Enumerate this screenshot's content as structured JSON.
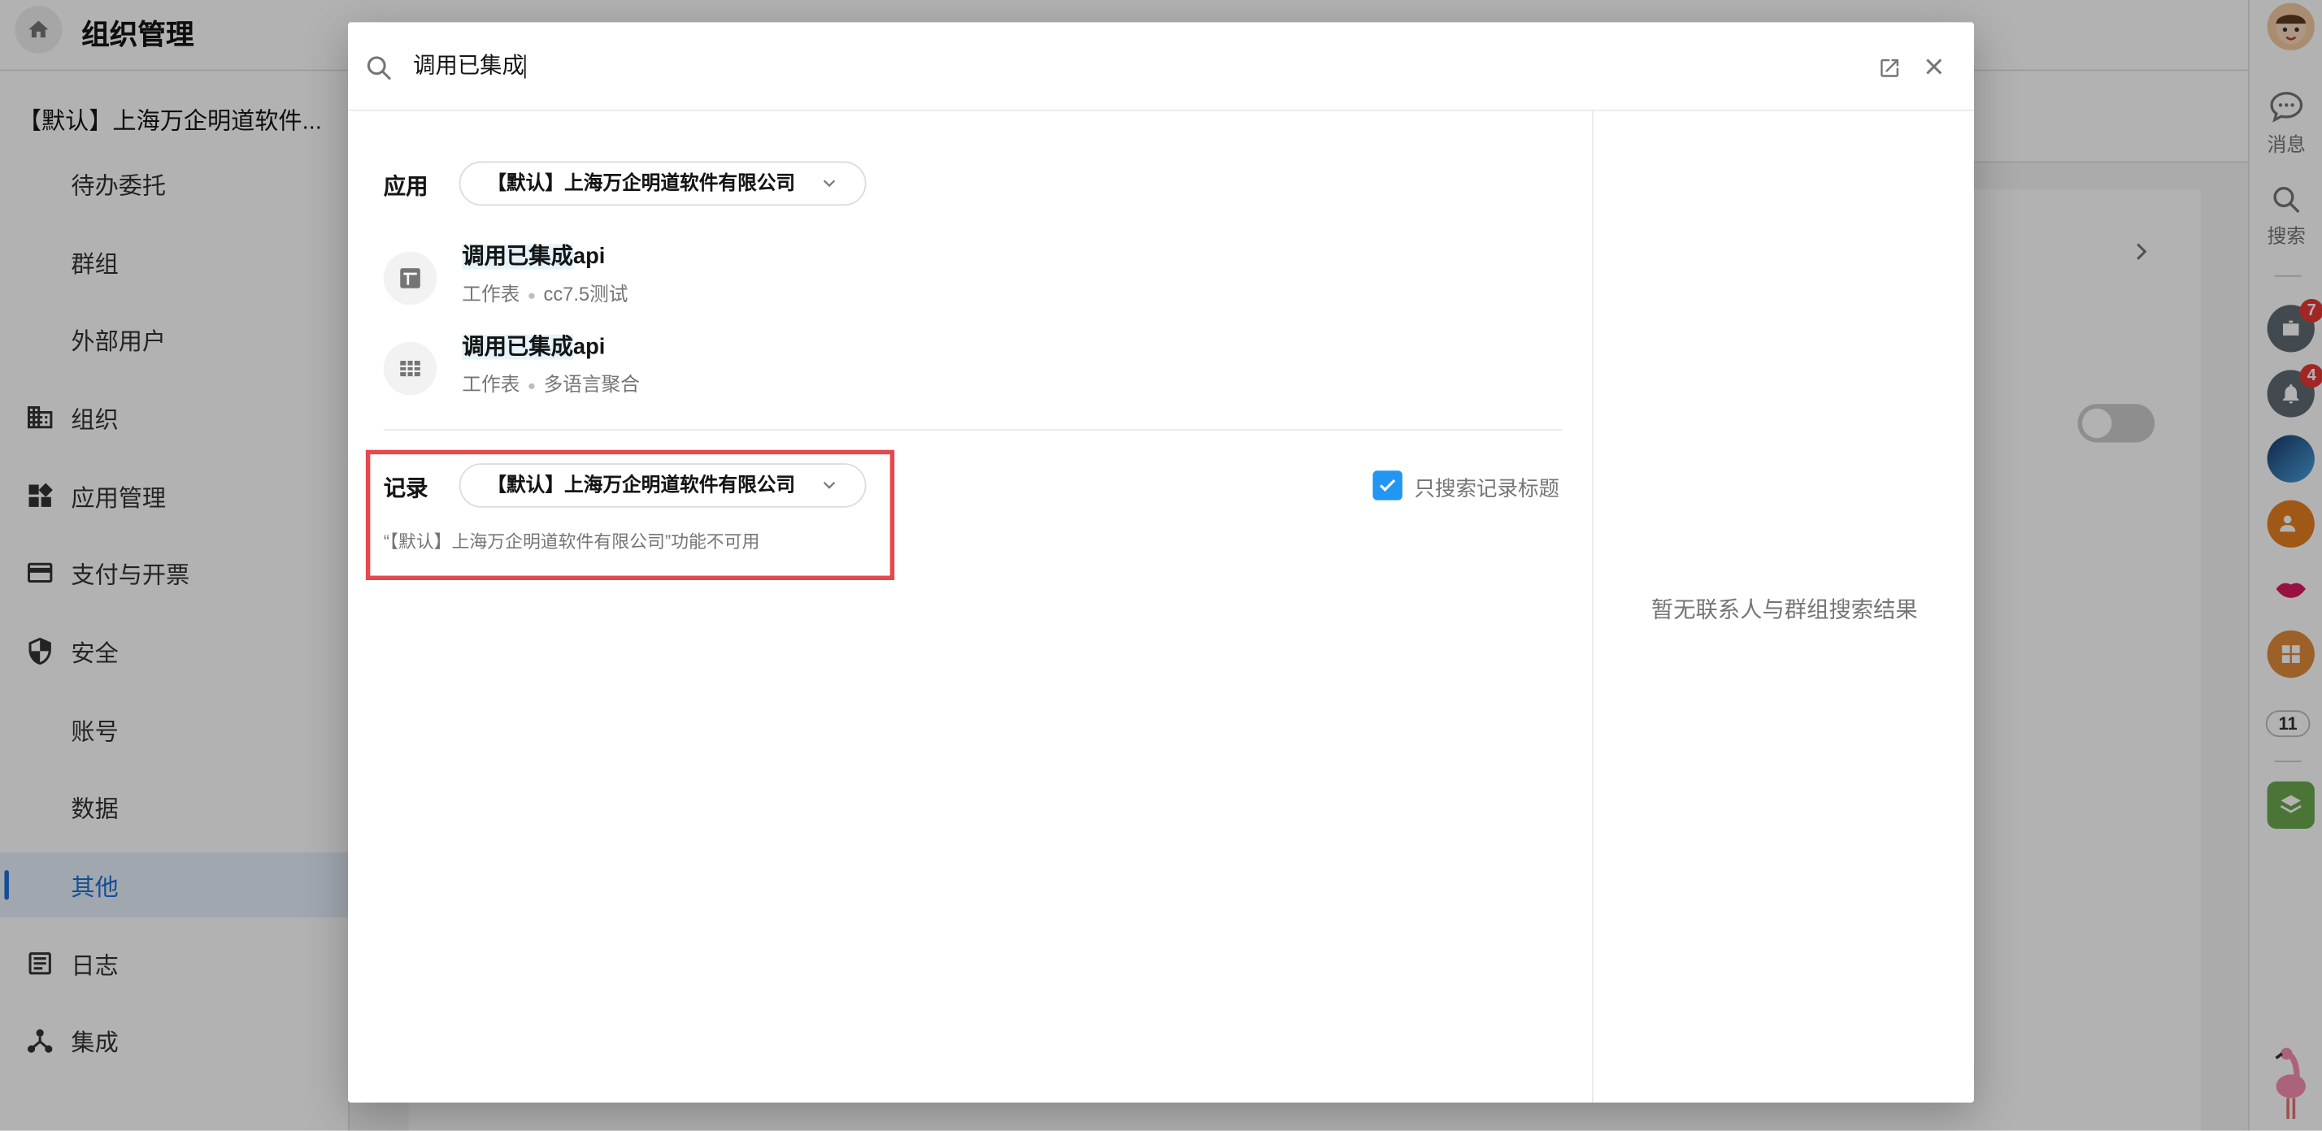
{
  "topbar": {
    "title": "组织管理"
  },
  "sidebar": {
    "org_name": "【默认】上海万企明道软件...",
    "items": [
      {
        "label": "待办委托",
        "icon": ""
      },
      {
        "label": "群组",
        "icon": ""
      },
      {
        "label": "外部用户",
        "icon": ""
      },
      {
        "label": "组织",
        "icon": "building-icon"
      },
      {
        "label": "应用管理",
        "icon": "widgets-icon"
      },
      {
        "label": "支付与开票",
        "icon": "credit-card-icon"
      },
      {
        "label": "安全",
        "icon": "shield-icon"
      },
      {
        "label": "账号",
        "icon": ""
      },
      {
        "label": "数据",
        "icon": ""
      },
      {
        "label": "其他",
        "icon": "",
        "active": true
      },
      {
        "label": "日志",
        "icon": "log-icon"
      },
      {
        "label": "集成",
        "icon": "integration-icon"
      }
    ]
  },
  "rail": {
    "messages_label": "消息",
    "search_label": "搜索",
    "badge_tasks": "7",
    "badge_notifications": "4",
    "more_count": "11"
  },
  "search": {
    "query": "调用已集成"
  },
  "apps_section": {
    "label": "应用",
    "scope": "【默认】上海万企明道软件有限公司",
    "results": [
      {
        "title_highlight": "调用已集成",
        "title_rest": "api",
        "type": "工作表",
        "app": "cc7.5测试",
        "icon": "custom-sheet-icon"
      },
      {
        "title_highlight": "调用已集成",
        "title_rest": "api",
        "type": "工作表",
        "app": "多语言聚合",
        "icon": "table-icon"
      }
    ]
  },
  "records_section": {
    "label": "记录",
    "scope": "【默认】上海万企明道软件有限公司",
    "unavailable_text": "“【默认】上海万企明道软件有限公司”功能不可用",
    "title_only_label": "只搜索记录标题",
    "title_only_checked": true
  },
  "contacts_section": {
    "empty_text": "暂无联系人与群组搜索结果"
  }
}
